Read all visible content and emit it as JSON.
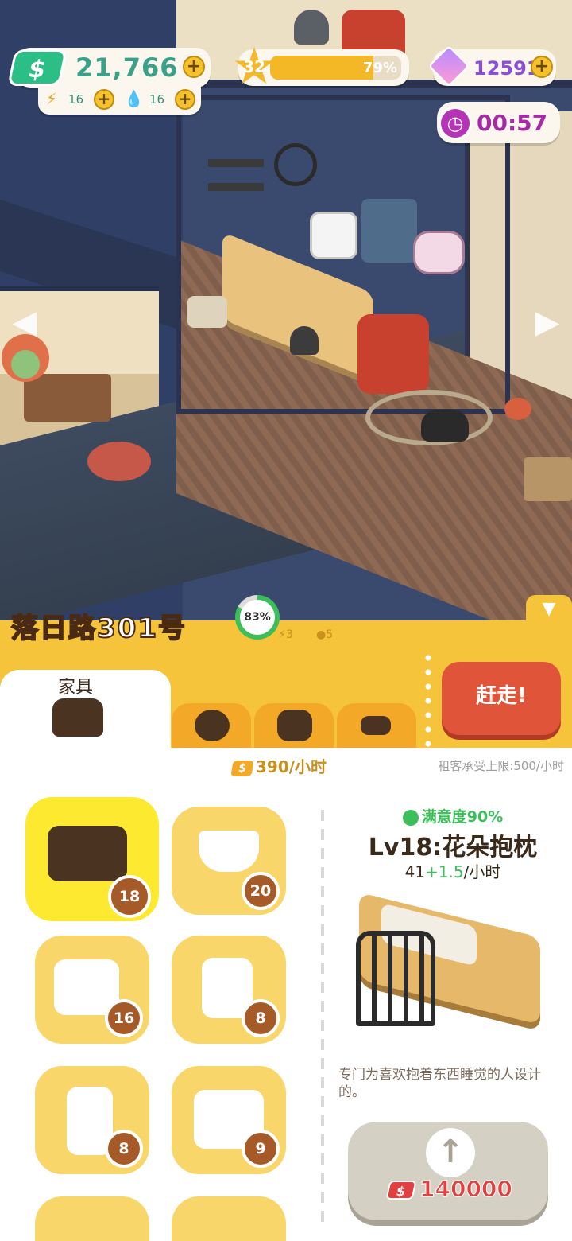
{
  "hud": {
    "cash": "21,766",
    "cash_icon": "$",
    "energy": "16",
    "water": "16",
    "level": "32",
    "level_progress_label": "79%",
    "level_progress": 0.79,
    "gems": "12591",
    "timer": "00:57",
    "plus": "+"
  },
  "location": {
    "address": "落日路301号",
    "satisfaction": "83%",
    "satisfaction_fraction": 0.83,
    "energy_req": "3",
    "water_req": "5"
  },
  "nav": {
    "left": "◀",
    "right": "▶",
    "collapse": "▼"
  },
  "tabs": {
    "furniture": "家具",
    "icons": [
      "tenant-face-icon",
      "cat-icon",
      "bone-icon"
    ]
  },
  "evict_label": "赶走!",
  "income": "390/小时",
  "income_icon": "$",
  "tenant_cap": "租客承受上限:500/小时",
  "items": [
    {
      "name": "bed",
      "icon": "bed-icon",
      "level": "18",
      "selected": true
    },
    {
      "name": "range-hood",
      "icon": "range-hood-icon",
      "level": "20"
    },
    {
      "name": "sofa",
      "icon": "armchair-icon",
      "level": "16"
    },
    {
      "name": "toilet",
      "icon": "toilet-icon",
      "level": "8"
    },
    {
      "name": "fridge",
      "icon": "fridge-icon",
      "level": "8"
    },
    {
      "name": "cabinet",
      "icon": "cabinet-icon",
      "level": "9"
    }
  ],
  "detail": {
    "satisfaction": "满意度90%",
    "name": "Lv18:花朵抱枕",
    "rate_base": "41",
    "rate_bonus": "+1.5",
    "rate_unit": "/小时",
    "description": "专门为喜欢抱着东西睡觉的人设计的。",
    "upgrade_icon": "↑",
    "upgrade_cost": "140000",
    "upgrade_cost_icon": "$"
  },
  "colors": {
    "accent_yellow": "#f6c43b",
    "evict_red": "#e0553a",
    "cash_green": "#2bbf86",
    "gem_purple": "#8a4fd6",
    "timer_magenta": "#a62aa6",
    "satisfaction_green": "#3cbf5b",
    "cost_red": "#e24040"
  }
}
